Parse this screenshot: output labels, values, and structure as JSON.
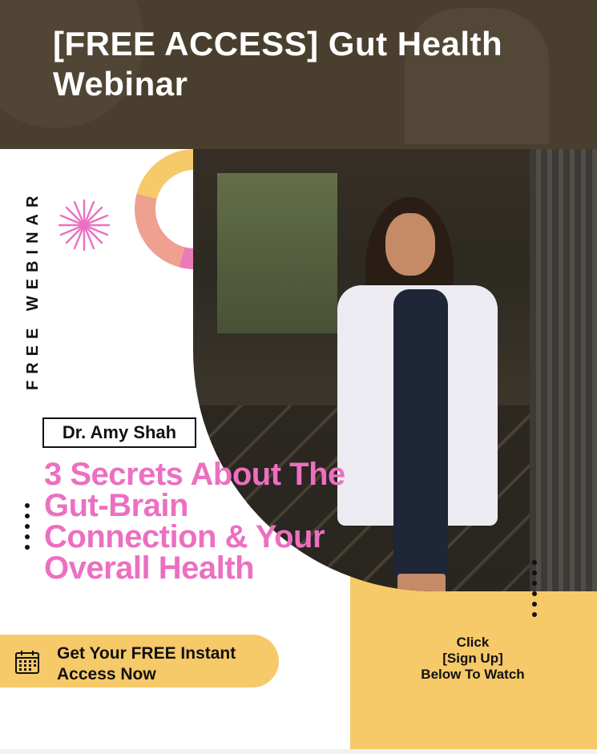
{
  "header": {
    "title": "[FREE ACCESS] Gut Health Webinar"
  },
  "poster": {
    "side_label": "FREE WEBINAR",
    "presenter_name": "Dr. Amy Shah",
    "headline": "3 Secrets About The Gut-Brain Connection & Your Overall Health",
    "cta": {
      "text": "Get Your FREE Instant Access Now",
      "icon": "calendar-icon"
    },
    "click_instructions": [
      "Click",
      "[Sign Up]",
      "Below To Watch"
    ],
    "decor": {
      "sparkle_icon": "sparkle-icon",
      "photo_subject": "presenter-photo"
    }
  },
  "colors": {
    "header_bg": "#4a3f2e",
    "accent_yellow": "#f6c969",
    "accent_pink": "#ec6fc1",
    "text_dark": "#111111"
  }
}
